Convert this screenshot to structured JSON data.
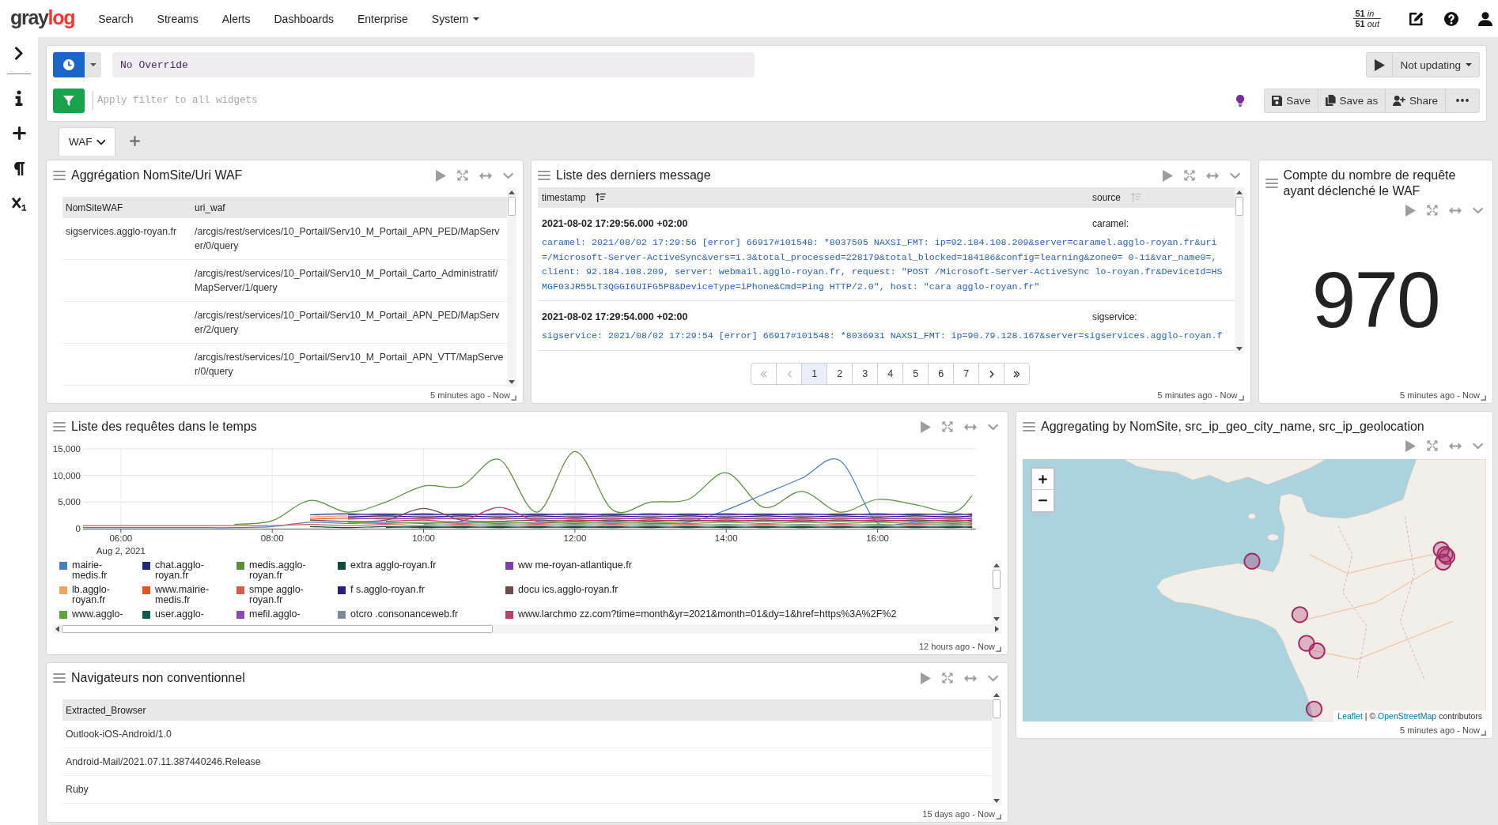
{
  "top_nav": {
    "logo": [
      {
        "text": "gray",
        "color": "#3a3a3a"
      },
      {
        "text": "log",
        "color": "#ff3633"
      }
    ],
    "items": [
      {
        "label": "Search",
        "dropdown": false
      },
      {
        "label": "Streams",
        "dropdown": false
      },
      {
        "label": "Alerts",
        "dropdown": false
      },
      {
        "label": "Dashboards",
        "dropdown": false
      },
      {
        "label": "Enterprise",
        "dropdown": false
      },
      {
        "label": "System",
        "dropdown": true
      }
    ],
    "throughput": {
      "in_value": "51",
      "in_unit": "in",
      "out_value": "51",
      "out_unit": "out"
    }
  },
  "query_bar": {
    "time_range": "No Override",
    "filter": {
      "placeholder": "Apply filter to all widgets"
    },
    "refresh": "Not updating",
    "actions": [
      {
        "kind": "save",
        "label": "Save"
      },
      {
        "kind": "save-as",
        "label": "Save as"
      },
      {
        "kind": "share",
        "label": "Share"
      },
      {
        "kind": "more"
      }
    ]
  },
  "tabs": [
    {
      "label": "WAF",
      "selected": true
    }
  ],
  "widgets": [
    {
      "kind": "table",
      "title": "Aggrégation NomSite/Uri WAF",
      "columns": [
        "NomSiteWAF",
        "uri_waf"
      ],
      "rows": [
        [
          "sigservices.agglo-royan.fr",
          "/arcgis/rest/services/10_Portail/Serv10_M_Portail_APN_PED/MapServer/0/query"
        ],
        [
          null,
          "/arcgis/rest/services/10_Portail/Serv10_M_Portail_Carto_Administratif/MapServer/1/query"
        ],
        [
          null,
          "/arcgis/rest/services/10_Portail/Serv10_M_Portail_APN_PED/MapServer/2/query"
        ],
        [
          null,
          "/arcgis/rest/services/10_Portail/Serv10_M_Portail_APN_VTT/MapServer/0/query"
        ]
      ],
      "footer": "5 minutes ago - Now"
    },
    {
      "kind": "messages",
      "title": "Liste des derniers message",
      "columns": [
        {
          "label": "timestamp",
          "sorted": true
        },
        {
          "label": "source",
          "sorted": false
        }
      ],
      "messages": [
        {
          "timestamp": "2021-08-02 17:29:56.000 +02:00",
          "source": "caramel:",
          "text": "caramel: 2021/08/02 17:29:56 [error] 66917#101548: *8037505 NAXSI_FMT: ip=92.184.108.209&server=caramel.agglo-royan.fr&uri=/Microsoft-Server-ActiveSync&vers=1.3&total_processed=228179&total_blocked=184186&config=learning&zone0= 0-11&var_name0=, client: 92.184.108.209, server: webmail.agglo-royan.fr, request: \"POST /Microsoft-Server-ActiveSync lo-royan.fr&DeviceId=HSMGF03JR55LT3QGGI6UIFG5P8&DeviceType=iPhone&Cmd=Ping HTTP/2.0\", host: \"cara agglo-royan.fr\""
        },
        {
          "timestamp": "2021-08-02 17:29:54.000 +02:00",
          "source": "sigservice:",
          "text": "sigservice: 2021/08/02 17:29:54 [error] 66917#101548: *8036931 NAXSI_FMT: ip=90.79.128.167&server=sigservices.agglo-royan.f"
        }
      ],
      "pagination": {
        "nav_before": [
          {
            "kind": "first",
            "disabled": true
          },
          {
            "kind": "previous",
            "disabled": true
          }
        ],
        "pages": [
          {
            "label": "1",
            "selected": true
          },
          {
            "label": "2",
            "selected": false
          },
          {
            "label": "3",
            "selected": false
          },
          {
            "label": "4",
            "selected": false
          },
          {
            "label": "5",
            "selected": false
          },
          {
            "label": "6",
            "selected": false
          },
          {
            "label": "7",
            "selected": false
          }
        ],
        "nav_after": [
          {
            "kind": "next",
            "disabled": false
          },
          {
            "kind": "last",
            "disabled": false
          }
        ]
      },
      "footer": "5 minutes ago - Now"
    },
    {
      "kind": "number",
      "title": "Compte du nombre de requête ayant déclenché le WAF",
      "value": "970",
      "footer": "5 minutes ago - Now"
    },
    {
      "kind": "chart",
      "title": "Liste des requêtes dans le temps",
      "date_label": "Aug 2, 2021",
      "chart_data": {
        "type": "line",
        "grid": true,
        "legend": true,
        "x": [
          5.5,
          6,
          6.5,
          7,
          7.5,
          8,
          8.5,
          9,
          9.5,
          10,
          10.5,
          11,
          11.5,
          12,
          12.5,
          13,
          13.5,
          14,
          14.5,
          15,
          15.5,
          16,
          16.5,
          17,
          17.25
        ],
        "xlim": [
          5.5,
          17.3
        ],
        "ylim": [
          0,
          15000
        ],
        "xticks": [
          {
            "value": 6,
            "label": "06:00"
          },
          {
            "value": 8,
            "label": "08:00"
          },
          {
            "value": 10,
            "label": "10:00"
          },
          {
            "value": 12,
            "label": "12:00"
          },
          {
            "value": 14,
            "label": "14:00"
          },
          {
            "value": 16,
            "label": "16:00"
          }
        ],
        "yticks": [
          {
            "value": 0,
            "label": "0"
          },
          {
            "value": 5000,
            "label": "5,000"
          },
          {
            "value": 10000,
            "label": "10,000"
          },
          {
            "value": 15000,
            "label": "15,000"
          }
        ],
        "series": [
          {
            "name": "mairie-medis.fr",
            "color": "#4a7fc1",
            "values": [
              200,
              200,
              200,
              200,
              200,
              400,
              1200,
              1000,
              1200,
              1000,
              1200,
              1000,
              1200,
              1000,
              1200,
              1000,
              1200,
              3500,
              6500,
              9500,
              12800,
              1000,
              1200,
              1000,
              1200
            ]
          },
          {
            "name": "chat.agglo-royan.fr",
            "color": "#1d2a78",
            "values": [
              null,
              null,
              null,
              null,
              null,
              null,
              2600,
              2800,
              2600,
              2800,
              2600,
              2800,
              2600,
              2800,
              2600,
              2800,
              2600,
              2800,
              2600,
              2800,
              2600,
              2800,
              2600,
              2800,
              2600
            ]
          },
          {
            "name": "medis.agglo-royan.fr",
            "color": "#5b8f3d",
            "values": [
              null,
              null,
              null,
              null,
              800,
              1500,
              5300,
              3100,
              5000,
              8000,
              8000,
              13000,
              3100,
              14500,
              3500,
              5000,
              5500,
              10500,
              4000,
              7000,
              3100,
              5500,
              4500,
              3100,
              6200
            ]
          },
          {
            "name": "extra agglo-royan.fr",
            "color": "#0e4d3d",
            "values": [
              null,
              null,
              null,
              null,
              null,
              null,
              400,
              200,
              400,
              200,
              400,
              200,
              400,
              200,
              400,
              200,
              400,
              200,
              400,
              200,
              400,
              200,
              400,
              200,
              400
            ]
          },
          {
            "name": "ww me-royan-atlantique.fr",
            "color": "#7b3fae",
            "values": [
              null,
              null,
              null,
              null,
              null,
              null,
              null,
              2600,
              2800,
              2600,
              2800,
              2600,
              2800,
              2600,
              2800,
              2600,
              2800,
              2600,
              2800,
              2600,
              2800,
              2600,
              2800,
              2600,
              2800
            ]
          },
          {
            "name": "lb.agglo-royan.fr",
            "color": "#f6a35b",
            "values": [
              null,
              null,
              null,
              null,
              null,
              null,
              2200,
              2400,
              2200,
              2400,
              2200,
              2400,
              2200,
              2400,
              2200,
              2400,
              2200,
              2400,
              2200,
              2400,
              2200,
              2400,
              2200,
              2400,
              2200
            ]
          },
          {
            "name": "www.mairie-medis.fr",
            "color": "#e5521c",
            "values": [
              null,
              null,
              null,
              null,
              null,
              null,
              1800,
              2000,
              1800,
              2000,
              1800,
              2000,
              1800,
              2000,
              1800,
              2000,
              1800,
              2000,
              1800,
              2000,
              1800,
              2000,
              1800,
              2000,
              1800
            ]
          },
          {
            "name": "smpe agglo-royan.fr",
            "color": "#dc5a4b",
            "values": [
              600,
              600,
              600,
              600,
              600,
              600,
              800,
              600,
              800,
              600,
              800,
              600,
              800,
              600,
              800,
              600,
              800,
              600,
              800,
              600,
              800,
              600,
              800,
              600,
              800
            ]
          },
          {
            "name": "f s.agglo-royan.fr",
            "color": "#2c1a8b",
            "values": [
              null,
              null,
              null,
              null,
              null,
              null,
              null,
              2200,
              2400,
              2200,
              2400,
              2200,
              2400,
              2200,
              2400,
              2200,
              2400,
              2200,
              2400,
              2200,
              2400,
              2200,
              2400,
              2200,
              2400
            ]
          },
          {
            "name": "docu ics.agglo-royan.fr",
            "color": "#6b4c46",
            "values": [
              null,
              null,
              null,
              null,
              null,
              null,
              1600,
              1400,
              1600,
              3800,
              1600,
              1400,
              1600,
              1400,
              1600,
              1400,
              1600,
              1400,
              1600,
              1400,
              1600,
              1400,
              1600,
              1400,
              1600
            ]
          },
          {
            "name": "www.agglo-",
            "color": "#5da23c",
            "values": [
              null,
              null,
              null,
              null,
              null,
              null,
              null,
              1200,
              1000,
              1200,
              1000,
              1200,
              1000,
              1200,
              1000,
              1200,
              1000,
              1200,
              1000,
              1200,
              1000,
              1200,
              1000,
              1200,
              1000
            ]
          },
          {
            "name": "user.agglo-",
            "color": "#0f5a48",
            "values": [
              null,
              null,
              null,
              null,
              null,
              null,
              null,
              null,
              200,
              400,
              200,
              400,
              200,
              400,
              200,
              400,
              200,
              400,
              200,
              400,
              200,
              400,
              200,
              400,
              200
            ]
          },
          {
            "name": "mefil.agglo-",
            "color": "#8a4bba",
            "values": [
              null,
              null,
              null,
              null,
              null,
              null,
              null,
              1800,
              2000,
              1800,
              2000,
              1800,
              2000,
              1800,
              2000,
              1800,
              2000,
              1800,
              2000,
              1800,
              2000,
              1800,
              2000,
              1800,
              2000
            ]
          },
          {
            "name": "otcro .consonanceweb.fr",
            "color": "#7e8a96",
            "values": [
              null,
              null,
              null,
              null,
              null,
              null,
              null,
              null,
              null,
              800,
              600,
              800,
              600,
              800,
              600,
              800,
              600,
              800,
              600,
              800,
              600,
              800,
              600,
              800,
              600
            ]
          },
          {
            "name": "www.larchmo zz.com?time=month&yr=2021&month=01&dy=1&href=https%3A%2F%2",
            "color": "#c33a6c",
            "values": [
              null,
              null,
              null,
              null,
              null,
              null,
              null,
              null,
              1400,
              1600,
              1400,
              4000,
              1400,
              1600,
              1400,
              1600,
              1400,
              1600,
              1400,
              1600,
              1400,
              1600,
              1400,
              1600,
              1400
            ]
          }
        ]
      },
      "footer": "12 hours ago - Now"
    },
    {
      "kind": "map",
      "title": "Aggregating by NomSite, src_ip_geo_city_name, src_ip_geolocation",
      "attribution": {
        "library": "Leaflet",
        "separator": "| ©",
        "source": "OpenStreetMap",
        "suffix": "contributors"
      },
      "footer": "5 minutes ago - Now"
    },
    {
      "kind": "table",
      "title": "Navigateurs non conventionnel",
      "columns": [
        "Extracted_Browser"
      ],
      "rows": [
        [
          "Outlook-iOS-Android/1.0"
        ],
        [
          "Android-Mail/2021.07.11.387440246.Release"
        ],
        [
          "Ruby"
        ]
      ],
      "footer": "15 days ago - Now"
    }
  ]
}
